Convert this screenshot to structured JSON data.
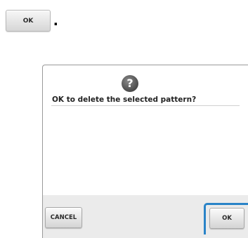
{
  "sample": {
    "ok_label": "OK",
    "trailing_punctuation": "."
  },
  "dialog": {
    "icon": "question-icon",
    "icon_glyph": "?",
    "message": "OK to delete the selected pattern?",
    "cancel_label": "CANCEL",
    "ok_label": "OK"
  },
  "colors": {
    "highlight": "#2a84c8",
    "footer_bg": "#ebebeb"
  }
}
